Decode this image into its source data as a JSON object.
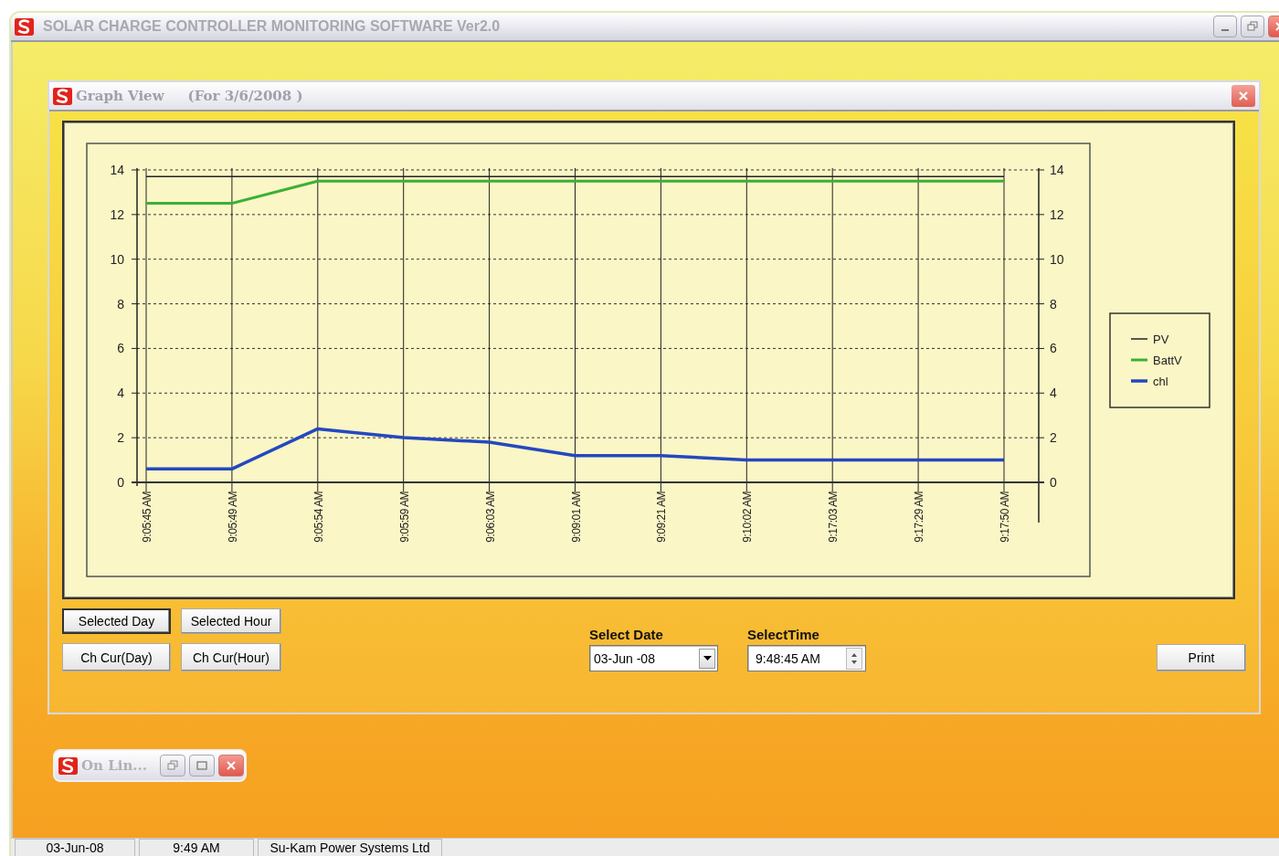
{
  "window": {
    "title": "SOLAR CHARGE CONTROLLER MONITORING SOFTWARE Ver2.0"
  },
  "graph_window": {
    "title": "Graph View",
    "subtitle": "(For 3/6/2008 )",
    "chart_data": {
      "type": "line",
      "categories": [
        "9:05:45 AM",
        "9:05:49 AM",
        "9:05:54 AM",
        "9:05:59 AM",
        "9:06:03 AM",
        "9:09:01 AM",
        "9:09:21 AM",
        "9:10:02 AM",
        "9:17:03 AM",
        "9:17:29 AM",
        "9:17:50 AM"
      ],
      "ylim": [
        0,
        14
      ],
      "yticks": [
        0,
        2,
        4,
        6,
        8,
        10,
        12,
        14
      ],
      "y2lim": [
        0,
        14
      ],
      "y2ticks": [
        0,
        2,
        4,
        6,
        8,
        10,
        12,
        14
      ],
      "grid": true,
      "legend": true,
      "series": [
        {
          "name": "PV",
          "color": "#222222",
          "values": [
            13.7,
            13.7,
            13.7,
            13.7,
            13.7,
            13.7,
            13.7,
            13.7,
            13.7,
            13.7,
            13.7
          ]
        },
        {
          "name": "BattV",
          "color": "#3cb034",
          "values": [
            12.5,
            12.5,
            13.5,
            13.5,
            13.5,
            13.5,
            13.5,
            13.5,
            13.5,
            13.5,
            13.5
          ]
        },
        {
          "name": "chl",
          "color": "#2448c0",
          "values": [
            0.6,
            0.6,
            2.4,
            2.0,
            1.8,
            1.2,
            1.2,
            1.0,
            1.0,
            1.0,
            1.0
          ]
        }
      ]
    },
    "mode_buttons": [
      {
        "label": "Selected Day",
        "selected": true
      },
      {
        "label": "Selected Hour",
        "selected": false
      }
    ],
    "current_buttons": [
      "Ch Cur(Day)",
      "Ch Cur(Hour)"
    ],
    "select_date": {
      "label": "Select Date",
      "value": "03-Jun -08"
    },
    "select_time": {
      "label": "SelectTime",
      "value": "9:48:45 AM"
    },
    "print_button": "Print"
  },
  "minimized_window": {
    "title": "On Lin..."
  },
  "status_bar": [
    "03-Jun-08",
    "9:49 AM",
    "Su-Kam Power Systems Ltd"
  ]
}
